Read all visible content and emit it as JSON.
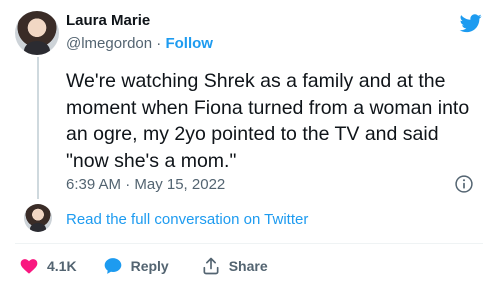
{
  "author": {
    "name": "Laura Marie",
    "handle": "@lmegordon",
    "separator": "·",
    "follow_label": "Follow"
  },
  "tweet": {
    "text": "We're watching Shrek as a family and at the moment when Fiona turned from a woman into an ogre, my 2yo pointed to the TV and said \"now she's a mom.\"",
    "timestamp": "6:39 AM · May 15, 2022"
  },
  "conversation": {
    "link_label": "Read the full conversation on Twitter"
  },
  "actions": {
    "like_count": "4.1K",
    "reply_label": "Reply",
    "share_label": "Share"
  },
  "colors": {
    "accent": "#1d9bf0",
    "like": "#f91880",
    "secondary_text": "#536471"
  },
  "icons": [
    "twitter-bird-icon",
    "info-icon",
    "heart-icon",
    "reply-bubble-icon",
    "share-icon"
  ]
}
